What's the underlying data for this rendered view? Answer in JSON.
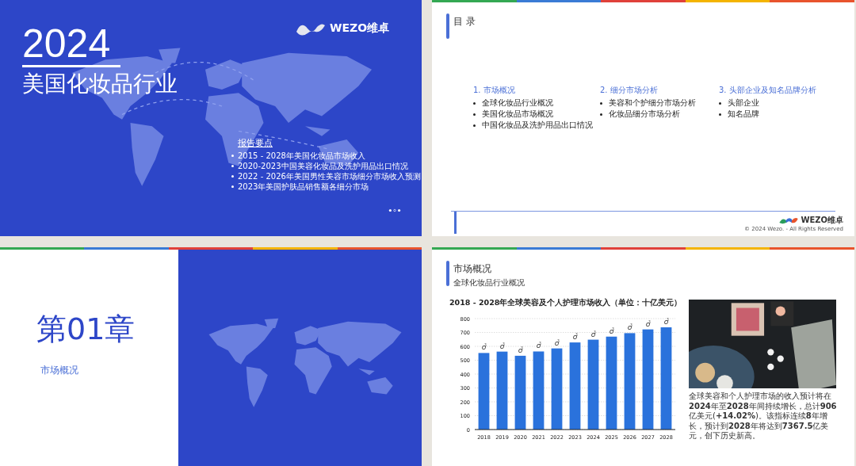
{
  "cover": {
    "year": "2024",
    "title": "美国化妆品行业",
    "logo": "WEZO维卓",
    "highlights_title": "报告要点",
    "highlights": [
      "2015 - 2028年美国化妆品市场收入",
      "2020-2023中国美容化妆品及洗护用品出口情况",
      "2022 - 2026年美国男性美容市场细分市场收入预测",
      "2023年美国护肤品销售额各细分市场"
    ]
  },
  "toc": {
    "title": "目 录",
    "sections": [
      {
        "heading": "1. 市场概况",
        "items": [
          "全球化妆品行业概况",
          "美国化妆品市场概况",
          "中国化妆品及洗护用品出口情况"
        ]
      },
      {
        "heading": "2. 细分市场分析",
        "items": [
          "美容和个护细分市场分析",
          "化妆品细分市场分析"
        ]
      },
      {
        "heading": "3. 头部企业及知名品牌分析",
        "items": [
          "头部企业",
          "知名品牌"
        ]
      }
    ],
    "logo": "WEZO维卓",
    "copyright": "© 2024 Wezo. - All Rights Reserved"
  },
  "chapter": {
    "heading": "第**01**章",
    "subtitle": "市场概况"
  },
  "market": {
    "title": "市场概况",
    "subtitle": "全球化妆品行业概况",
    "chart_data": {
      "type": "bar",
      "title": "2018 - 2028年全球美容及个人护理市场收入（单位：十亿美元）",
      "categories": [
        "2018",
        "2019",
        "2020",
        "2021",
        "2022",
        "2023",
        "2024",
        "2025",
        "2026",
        "2027",
        "2028"
      ],
      "grid": true,
      "series": [
        {
          "color": "#2a72dc",
          "values": [
            552,
            562,
            532,
            563,
            585,
            628,
            648,
            670,
            695,
            722,
            737
          ]
        }
      ],
      "ylim": [
        0,
        800
      ],
      "yticks": [
        0,
        100,
        200,
        300,
        400,
        500,
        600,
        700,
        800
      ],
      "value_labels": [
        "ở",
        "ở",
        "ở",
        "ở",
        "ở",
        "ở",
        "ở",
        "ở",
        "ở",
        "ở",
        "ở"
      ]
    },
    "paragraph": "全球美容和个人护理市场的收入预计将在**2024**年至**2028**年间持续增长，总计**906**亿美元(**+14.02%**)。该指标连续**8**年增长，预计到**2028**年将达到**7367.5**亿美元，创下历史新高。"
  }
}
